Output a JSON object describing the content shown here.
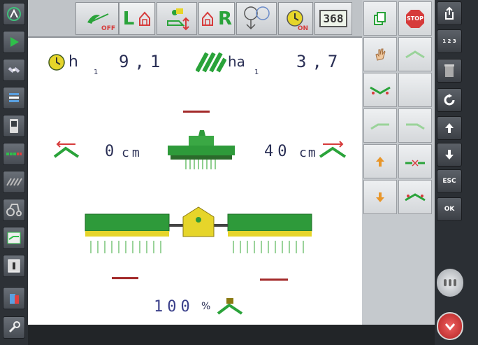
{
  "colors": {
    "accent_green": "#2aa33a",
    "cab_yellow": "#e6d52a",
    "marker_red": "#a32a2a",
    "value_blue": "#2a2f55",
    "icon_red": "#d63b3b"
  },
  "topbar": {
    "sc_off_label": "OFF",
    "left_label": "L",
    "right_label": "R",
    "timer_on_label": "ON",
    "counter_value": "368"
  },
  "stats": {
    "hours_unit": "h",
    "hours_sub": "1",
    "hours_value": "9,1",
    "area_unit": "ha",
    "area_sub": "1",
    "area_value": "3,7"
  },
  "offsets": {
    "left_value": "0",
    "left_unit": "cm",
    "right_value": "40",
    "right_unit": "cm"
  },
  "bottom_percent": {
    "value": "100",
    "unit": "%"
  },
  "softkeys": {
    "stop_label": "STOP"
  },
  "rightbar": {
    "numpad_label": "1 2 3",
    "esc_label": "ESC",
    "ok_label": "OK"
  },
  "icons": [
    "home-icon",
    "play-icon",
    "satellite-icon",
    "list-icon",
    "phone-icon",
    "pattern-icon",
    "swath-icon",
    "tractor-icon",
    "ramp-icon",
    "card-icon",
    "trash-icon",
    "wrench-icon"
  ]
}
